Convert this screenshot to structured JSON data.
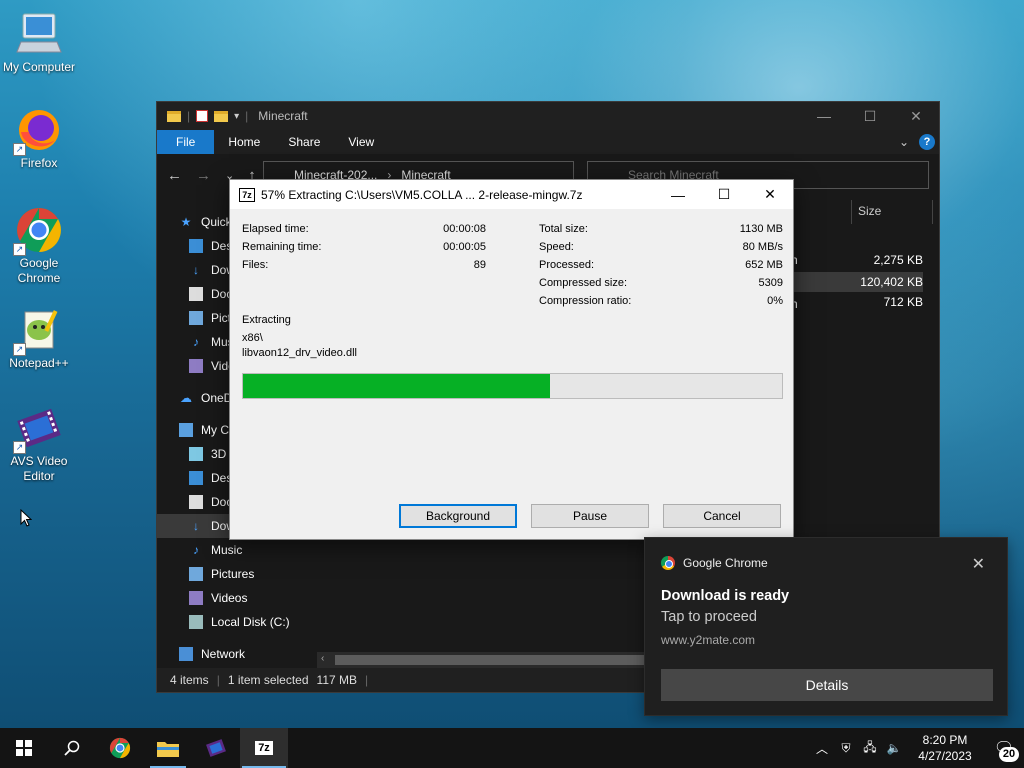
{
  "desktop": {
    "icons": [
      {
        "label": "My Computer",
        "icon": "monitor-icon"
      },
      {
        "label": "Firefox",
        "icon": "firefox-icon"
      },
      {
        "label": "Google Chrome",
        "icon": "chrome-icon"
      },
      {
        "label": "Notepad++",
        "icon": "notepadpp-icon"
      },
      {
        "label": "AVS Video Editor",
        "icon": "film-icon"
      }
    ]
  },
  "explorer": {
    "title": "Minecraft",
    "ribbon_tabs": [
      "File",
      "Home",
      "Share",
      "View"
    ],
    "address": {
      "segments": [
        "Minecraft-202...",
        "Minecraft"
      ]
    },
    "search_placeholder": "Search Minecraft",
    "column_size": "Size",
    "nav_items": [
      {
        "label": "Quick access",
        "icon": "star-icon"
      },
      {
        "label": "Desktop",
        "icon": "desktop-icon"
      },
      {
        "label": "Downloads",
        "icon": "download-icon"
      },
      {
        "label": "Documents",
        "icon": "document-icon"
      },
      {
        "label": "Pictures",
        "icon": "pictures-icon"
      },
      {
        "label": "Music",
        "icon": "music-icon"
      },
      {
        "label": "Videos",
        "icon": "videos-icon"
      },
      {
        "label": "OneDrive",
        "icon": "cloud-icon"
      },
      {
        "label": "My Computer",
        "icon": "computer-icon"
      },
      {
        "label": "3D Objects",
        "icon": "cube-icon"
      },
      {
        "label": "Desktop",
        "icon": "desktop-icon"
      },
      {
        "label": "Documents",
        "icon": "document-icon"
      },
      {
        "label": "Downloads",
        "icon": "download-icon"
      },
      {
        "label": "Music",
        "icon": "music-icon"
      },
      {
        "label": "Pictures",
        "icon": "pictures-icon"
      },
      {
        "label": "Videos",
        "icon": "videos-icon"
      },
      {
        "label": "Local Disk (C:)",
        "icon": "drive-icon"
      },
      {
        "label": "Network",
        "icon": "network-icon"
      }
    ],
    "file_sizes": [
      "2,275 KB",
      "120,402 KB",
      "712 KB"
    ],
    "status": {
      "items": "4 items",
      "selected": "1 item selected",
      "size": "117 MB"
    }
  },
  "sevenzip": {
    "title": "57% Extracting C:\\Users\\VM5.COLLA ... 2-release-mingw.7z",
    "progress_percent": 57,
    "left_labels": [
      "Elapsed time:",
      "Remaining time:",
      "Files:"
    ],
    "left_values": [
      "00:00:08",
      "00:00:05",
      "89"
    ],
    "right_labels": [
      "Total size:",
      "Speed:",
      "Processed:",
      "Compressed size:",
      "Compression ratio:"
    ],
    "right_values": [
      "1130 MB",
      "80 MB/s",
      "652 MB",
      "5309",
      "0%"
    ],
    "extracting_label": "Extracting",
    "current_dir": "x86\\",
    "current_file": "libvaon12_drv_video.dll",
    "buttons": {
      "background": "Background",
      "pause": "Pause",
      "cancel": "Cancel"
    }
  },
  "notification": {
    "app": "Google Chrome",
    "heading": "Download is ready",
    "subtext": "Tap to proceed",
    "source": "www.y2mate.com",
    "action": "Details"
  },
  "taskbar": {
    "clock_time": "8:20 PM",
    "clock_date": "4/27/2023",
    "notification_count": "20"
  },
  "colors": {
    "progress": "#06b025",
    "accent": "#1979ca"
  }
}
